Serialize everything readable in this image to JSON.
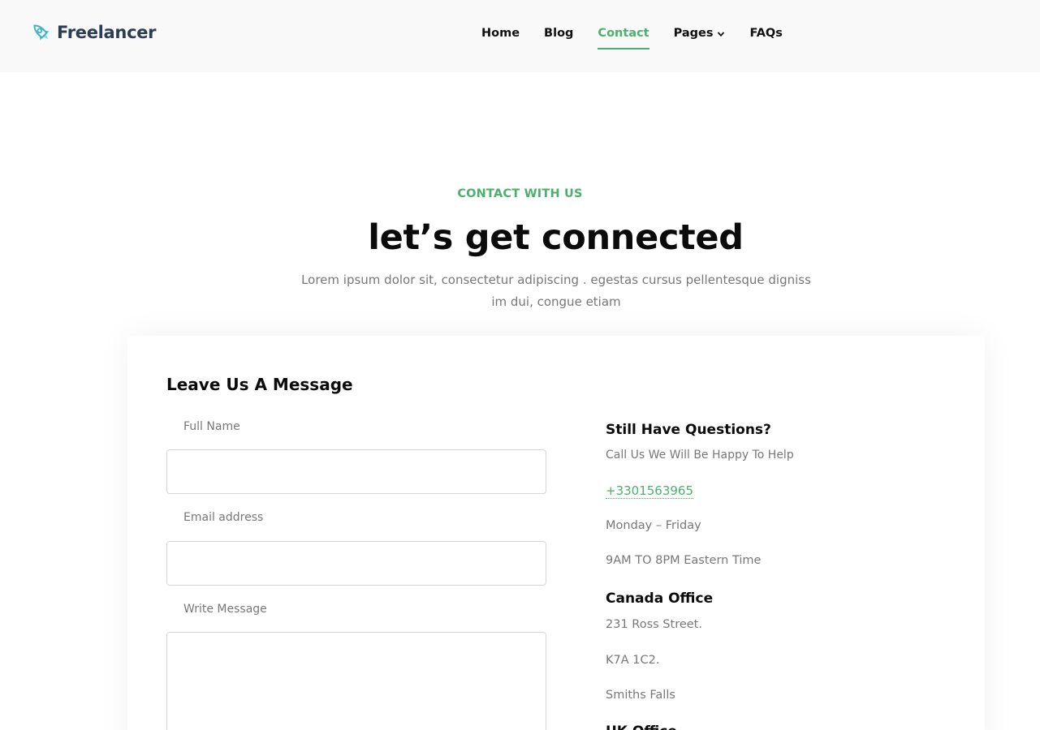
{
  "brand": {
    "name": "Freelancer",
    "accent": "#4caf6e",
    "logo_color": "#2c3e56",
    "icon": "rocket-icon"
  },
  "nav": {
    "items": [
      {
        "label": "Home"
      },
      {
        "label": "Blog"
      },
      {
        "label": "Contact",
        "active": true
      },
      {
        "label": "Pages",
        "has_dropdown": true
      },
      {
        "label": "FAQs"
      }
    ]
  },
  "hero": {
    "eyebrow": "CONTACT WITH US",
    "title": "let’s get connected",
    "description_line1": "Lorem ipsum dolor sit, consectetur adipiscing . egestas cursus pellentesque digniss",
    "description_line2": "im dui, congue etiam"
  },
  "form": {
    "title": "Leave Us A Message",
    "full_name_label": "Full Name",
    "full_name_value": "",
    "email_label": "Email address",
    "email_value": "",
    "message_label": "Write Message",
    "message_value": ""
  },
  "info": {
    "questions_heading": "Still Have Questions?",
    "questions_sub": "Call Us We Will Be Happy To Help",
    "phone": "+3301563965",
    "days": "Monday – Friday",
    "hours": "9AM TO 8PM Eastern Time",
    "canada_heading": "Canada Office",
    "canada_street": "231 Ross Street.",
    "canada_postal": "K7A 1C2.",
    "canada_city": "Smiths Falls",
    "uk_heading": "UK Office"
  }
}
